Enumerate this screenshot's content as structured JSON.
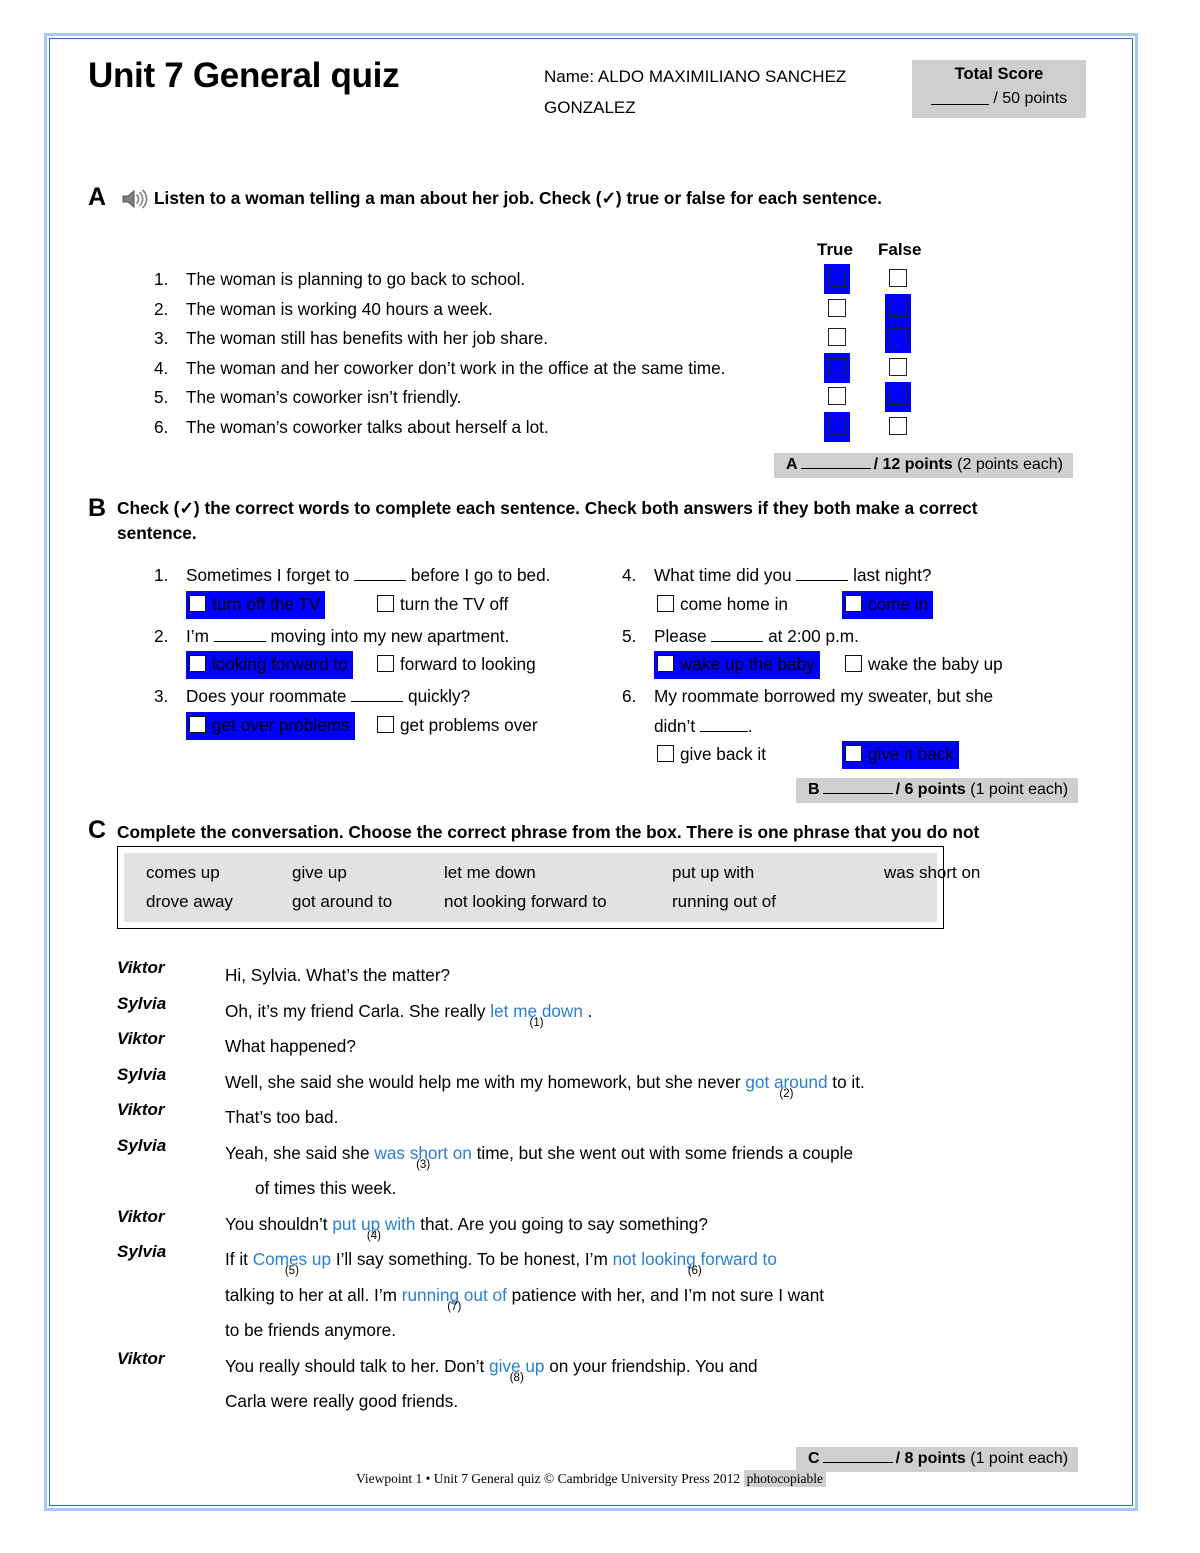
{
  "page": {
    "title": "Unit 7 General quiz",
    "name_label": "Name:",
    "name_value": "ALDO MAXIMILIANO SANCHEZ GONZALEZ",
    "name_line1": "Name: ALDO MAXIMILIANO SANCHEZ",
    "name_line2": "GONZALEZ",
    "accent_border": "#2b6cb8",
    "highlight_color": "#0000FF",
    "answer_color": "#2a7fd4",
    "shade_color": "#CFCFCF"
  },
  "total_score": {
    "title": "Total Score",
    "out_of": "/ 50 points"
  },
  "section_a": {
    "letter": "A",
    "icon": "audio-speaker-icon",
    "instructions": "Listen to a woman telling a man about her job. Check (✓) true or false for each sentence.",
    "col_true": "True",
    "col_false": "False",
    "items": [
      {
        "num": "1.",
        "text": "The woman is planning to go back to school.",
        "answer": "true"
      },
      {
        "num": "2.",
        "text": "The woman is working 40 hours a week.",
        "answer": "false"
      },
      {
        "num": "3.",
        "text": "The woman still has benefits with her job share.",
        "answer": "false"
      },
      {
        "num": "4.",
        "text": "The woman and her coworker don’t work in the office at the same time.",
        "answer": "true"
      },
      {
        "num": "5.",
        "text": "The woman’s coworker isn’t friendly.",
        "answer": "false"
      },
      {
        "num": "6.",
        "text": "The woman’s coworker talks about herself a lot.",
        "answer": "true"
      }
    ],
    "score": {
      "letter": "A",
      "points": "/ 12 points",
      "each": "(2 points each)"
    }
  },
  "section_b": {
    "letter": "B",
    "instructions": "Check (✓) the correct words to complete each sentence. Check both answers if they both make a correct sentence.",
    "items": [
      {
        "num": "1.",
        "q_before": "Sometimes I forget to",
        "q_after": "before I go to bed.",
        "opt_a": "turn off the TV",
        "opt_b": "turn the TV off",
        "selected": "a"
      },
      {
        "num": "2.",
        "q_before": "I’m",
        "q_after": "moving into my new apartment.",
        "opt_a": "looking forward to",
        "opt_b": "forward to looking",
        "selected": "a"
      },
      {
        "num": "3.",
        "q_before": "Does your roommate",
        "q_after": "quickly?",
        "opt_a": "get over problems",
        "opt_b": "get problems over",
        "selected": "a"
      },
      {
        "num": "4.",
        "q_before": "What time did you",
        "q_after": "last night?",
        "opt_a": "come home in",
        "opt_b": "come in",
        "selected": "b"
      },
      {
        "num": "5.",
        "q_before": "Please",
        "q_after": "at 2:00 p.m.",
        "opt_a": "wake up the baby",
        "opt_b": "wake the baby up",
        "selected": "a"
      },
      {
        "num": "6.",
        "q_before": "My roommate borrowed my sweater, but she",
        "q_line2_before": "didn’t",
        "q_after": ".",
        "opt_a": "give back it",
        "opt_b": "give it back",
        "selected": "b"
      }
    ],
    "score": {
      "letter": "B",
      "points": "/ 6 points",
      "each": "(1 point each)"
    }
  },
  "section_c": {
    "letter": "C",
    "instructions": "Complete the conversation. Choose the correct phrase from the box. There is one phrase that you do not need to use.",
    "word_box": {
      "row1": [
        "comes up",
        "give up",
        "let me down",
        "put up with",
        "was short on"
      ],
      "row2": [
        "drove away",
        "got around to",
        "not looking forward to",
        "running out of"
      ]
    },
    "conversation": [
      {
        "speaker": "Viktor",
        "parts": [
          {
            "t": "Hi, Sylvia. What’s the matter?"
          }
        ]
      },
      {
        "speaker": "Sylvia",
        "parts": [
          {
            "t": "Oh, it’s my friend Carla. She really "
          },
          {
            "a": "let me down",
            "n": "(1)"
          },
          {
            "t": " ."
          }
        ]
      },
      {
        "speaker": "Viktor",
        "parts": [
          {
            "t": "What happened?"
          }
        ]
      },
      {
        "speaker": "Sylvia",
        "parts": [
          {
            "t": "Well, she said she would help me with my homework, but she never "
          },
          {
            "a": "got around",
            "n": "(2)"
          },
          {
            "t": " to it."
          }
        ]
      },
      {
        "speaker": "Viktor",
        "parts": [
          {
            "t": "That’s too bad."
          }
        ]
      },
      {
        "speaker": "Sylvia",
        "parts": [
          {
            "t": "Yeah, she said she "
          },
          {
            "a": "was short on",
            "n": "(3)"
          },
          {
            "t": " time, but she went out with some friends a    couple"
          }
        ]
      },
      {
        "speaker": "",
        "parts": [
          {
            "t": "of times this week.",
            "indent": true
          }
        ]
      },
      {
        "speaker": "Viktor",
        "parts": [
          {
            "t": "You shouldn’t "
          },
          {
            "a": "put up with",
            "n": "(4)"
          },
          {
            "t": "  that. Are you going to say something?"
          }
        ]
      },
      {
        "speaker": "Sylvia",
        "parts": [
          {
            "t": "If it "
          },
          {
            "a": "Comes up",
            "n": "(5)"
          },
          {
            "t": "  I’ll say something. To be honest, I’m "
          },
          {
            "a": "not looking forward to",
            "n": "(6)"
          }
        ]
      },
      {
        "speaker": "",
        "parts": [
          {
            "t": "talking to her at all. I’m "
          },
          {
            "a": "running out of",
            "n": "(7)"
          },
          {
            "t": "  patience with her, and I’m not sure I want"
          }
        ]
      },
      {
        "speaker": "",
        "parts": [
          {
            "t": "to be friends anymore."
          }
        ]
      },
      {
        "speaker": "Viktor",
        "parts": [
          {
            "t": "You really should talk to her. Don’t "
          },
          {
            "a": "give up",
            "n": "(8)"
          },
          {
            "t": "  on your friendship. You and"
          }
        ]
      },
      {
        "speaker": "",
        "parts": [
          {
            "t": "Carla were really good friends."
          }
        ]
      }
    ],
    "score": {
      "letter": "C",
      "points": "/ 8 points",
      "each": "(1 point each)"
    }
  },
  "footer": {
    "text": "Viewpoint 1 • Unit 7 General quiz © Cambridge University Press 2012",
    "badge": "photocopiable"
  }
}
